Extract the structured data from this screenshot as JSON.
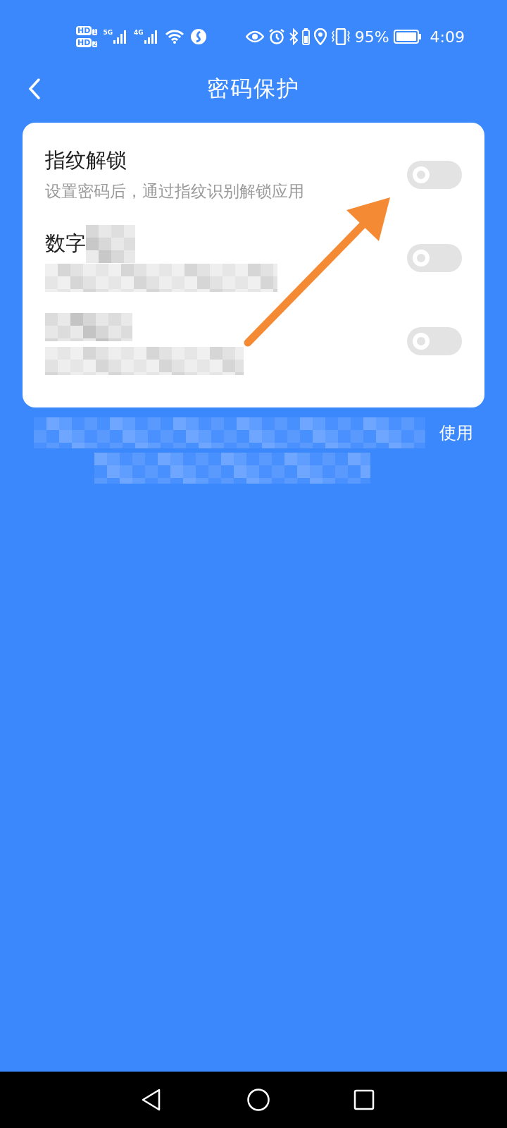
{
  "status_bar": {
    "sims": [
      {
        "badge": "HD",
        "slot": "1"
      },
      {
        "badge": "HD",
        "slot": "2"
      }
    ],
    "networks": [
      "5G",
      "4G"
    ],
    "battery_text": "95%",
    "time": "4:09"
  },
  "header": {
    "title": "密码保护"
  },
  "settings": [
    {
      "title": "指纹解锁",
      "subtitle": "设置密码后，通过指纹识别解锁应用",
      "checked": false,
      "redacted": false
    },
    {
      "title": "数字",
      "checked": false,
      "redacted": true
    },
    {
      "checked": false,
      "redacted": true
    }
  ],
  "footer_note": {
    "visible_text": "使用",
    "redacted": true
  }
}
